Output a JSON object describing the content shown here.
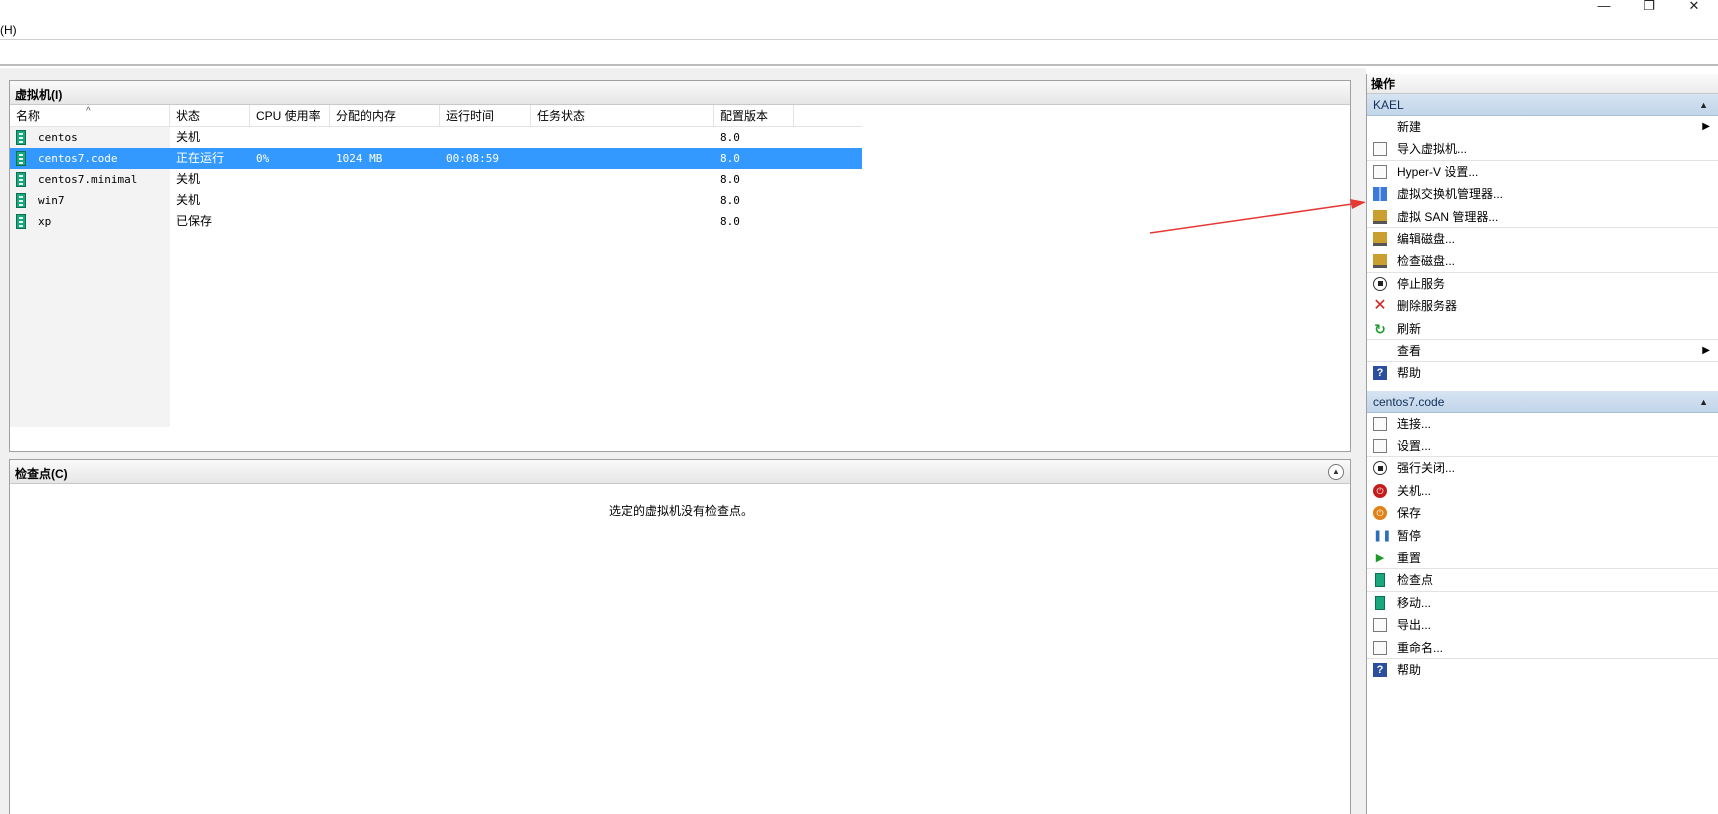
{
  "window": {
    "minimize_glyph": "—",
    "restore_glyph": "❐",
    "close_glyph": "✕"
  },
  "menu": {
    "help_label": "(H)"
  },
  "vm_pane": {
    "title": "虚拟机(I)",
    "columns": [
      "名称",
      "状态",
      "CPU 使用率",
      "分配的内存",
      "运行时间",
      "任务状态",
      "配置版本"
    ],
    "rows": [
      {
        "name": "centos",
        "status": "关机",
        "cpu": "",
        "memory": "",
        "uptime": "",
        "task": "",
        "version": "8.0",
        "selected": false
      },
      {
        "name": "centos7.code",
        "status": "正在运行",
        "cpu": "0%",
        "memory": "1024 MB",
        "uptime": "00:08:59",
        "task": "",
        "version": "8.0",
        "selected": true
      },
      {
        "name": "centos7.minimal",
        "status": "关机",
        "cpu": "",
        "memory": "",
        "uptime": "",
        "task": "",
        "version": "8.0",
        "selected": false
      },
      {
        "name": "win7",
        "status": "关机",
        "cpu": "",
        "memory": "",
        "uptime": "",
        "task": "",
        "version": "8.0",
        "selected": false
      },
      {
        "name": "xp",
        "status": "已保存",
        "cpu": "",
        "memory": "",
        "uptime": "",
        "task": "",
        "version": "8.0",
        "selected": false
      }
    ]
  },
  "checkpoint_pane": {
    "title": "检查点(C)",
    "empty_message": "选定的虚拟机没有检查点。"
  },
  "actions_pane": {
    "title": "操作",
    "server_group": {
      "title": "KAEL",
      "items": [
        {
          "label": "新建",
          "icon": "none",
          "submenu": true
        },
        {
          "label": "导入虚拟机...",
          "icon": "import-icon"
        },
        {
          "label": "Hyper-V 设置...",
          "icon": "settings-doc-icon"
        },
        {
          "label": "虚拟交换机管理器...",
          "icon": "switch-manager-icon"
        },
        {
          "label": "虚拟 SAN 管理器...",
          "icon": "san-manager-icon"
        },
        {
          "label": "编辑磁盘...",
          "icon": "edit-disk-icon"
        },
        {
          "label": "检查磁盘...",
          "icon": "inspect-disk-icon"
        },
        {
          "label": "停止服务",
          "icon": "stop-icon"
        },
        {
          "label": "删除服务器",
          "icon": "delete-icon"
        },
        {
          "label": "刷新",
          "icon": "refresh-icon"
        },
        {
          "label": "查看",
          "icon": "none",
          "submenu": true
        },
        {
          "label": "帮助",
          "icon": "help-icon"
        }
      ]
    },
    "vm_group": {
      "title": "centos7.code",
      "items": [
        {
          "label": "连接...",
          "icon": "connect-icon"
        },
        {
          "label": "设置...",
          "icon": "settings-doc-icon"
        },
        {
          "label": "强行关闭...",
          "icon": "turn-off-icon"
        },
        {
          "label": "关机...",
          "icon": "shutdown-icon"
        },
        {
          "label": "保存",
          "icon": "save-state-icon"
        },
        {
          "label": "暂停",
          "icon": "pause-icon"
        },
        {
          "label": "重置",
          "icon": "reset-icon"
        },
        {
          "label": "检查点",
          "icon": "checkpoint-icon"
        },
        {
          "label": "移动...",
          "icon": "move-icon"
        },
        {
          "label": "导出...",
          "icon": "export-icon"
        },
        {
          "label": "重命名...",
          "icon": "rename-icon"
        },
        {
          "label": "帮助",
          "icon": "help-icon"
        }
      ]
    }
  },
  "colors": {
    "selection": "#3399ff",
    "group_header": "#c9daee",
    "annotation_arrow": "#e53935"
  }
}
